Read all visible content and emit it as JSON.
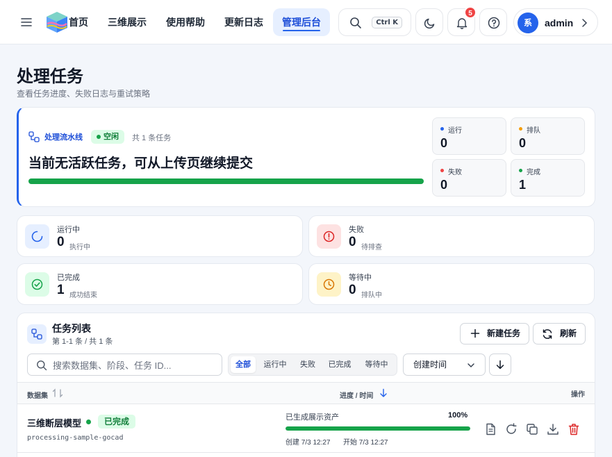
{
  "nav": {
    "items": [
      "首页",
      "三维展示",
      "使用帮助",
      "更新日志"
    ],
    "active": "管理后台",
    "search_shortcut": "Ctrl K",
    "notification_count": "5",
    "user_avatar": "系",
    "user_name": "admin"
  },
  "page": {
    "title": "处理任务",
    "subtitle": "查看任务进度、失败日志与重试策略"
  },
  "pipeline": {
    "label": "处理流水线",
    "status": "空闲",
    "count_text": "共 1 条任务",
    "headline": "当前无活跃任务，可从上传页继续提交",
    "progress": 1.0,
    "mini": [
      {
        "label": "运行",
        "value": "0",
        "color": "#2563eb"
      },
      {
        "label": "排队",
        "value": "0",
        "color": "#f59e0b"
      },
      {
        "label": "失败",
        "value": "0",
        "color": "#ef4444"
      },
      {
        "label": "完成",
        "value": "1",
        "color": "#16a34a"
      }
    ]
  },
  "stats": [
    {
      "label": "运行中",
      "value": "0",
      "sub": "执行中",
      "icon": "spinner-icon",
      "color": "#2563eb"
    },
    {
      "label": "失败",
      "value": "0",
      "sub": "待排查",
      "icon": "alert-icon",
      "color": "#dc2626"
    },
    {
      "label": "已完成",
      "value": "1",
      "sub": "成功结束",
      "icon": "check-circle-icon",
      "color": "#16a34a"
    },
    {
      "label": "等待中",
      "value": "0",
      "sub": "排队中",
      "icon": "clock-icon",
      "color": "#d97706"
    }
  ],
  "tasks": {
    "title": "任务列表",
    "subtitle": "第 1-1 条 / 共 1 条",
    "new_button": "新建任务",
    "refresh_button": "刷新",
    "search_placeholder": "搜索数据集、阶段、任务 ID...",
    "filters": [
      "全部",
      "运行中",
      "失败",
      "已完成",
      "等待中"
    ],
    "sort_label": "创建时间",
    "columns": {
      "dataset": "数据集",
      "progress": "进度 / 时间",
      "actions": "操作"
    },
    "rows": [
      {
        "name": "三维断层模型",
        "status": "已完成",
        "id": "processing-sample-gocad",
        "stage": "已生成展示资产",
        "percent": "100%",
        "progress": 1.0,
        "created": "创建 7/3 12:27",
        "started": "开始 7/3 12:27"
      }
    ]
  }
}
